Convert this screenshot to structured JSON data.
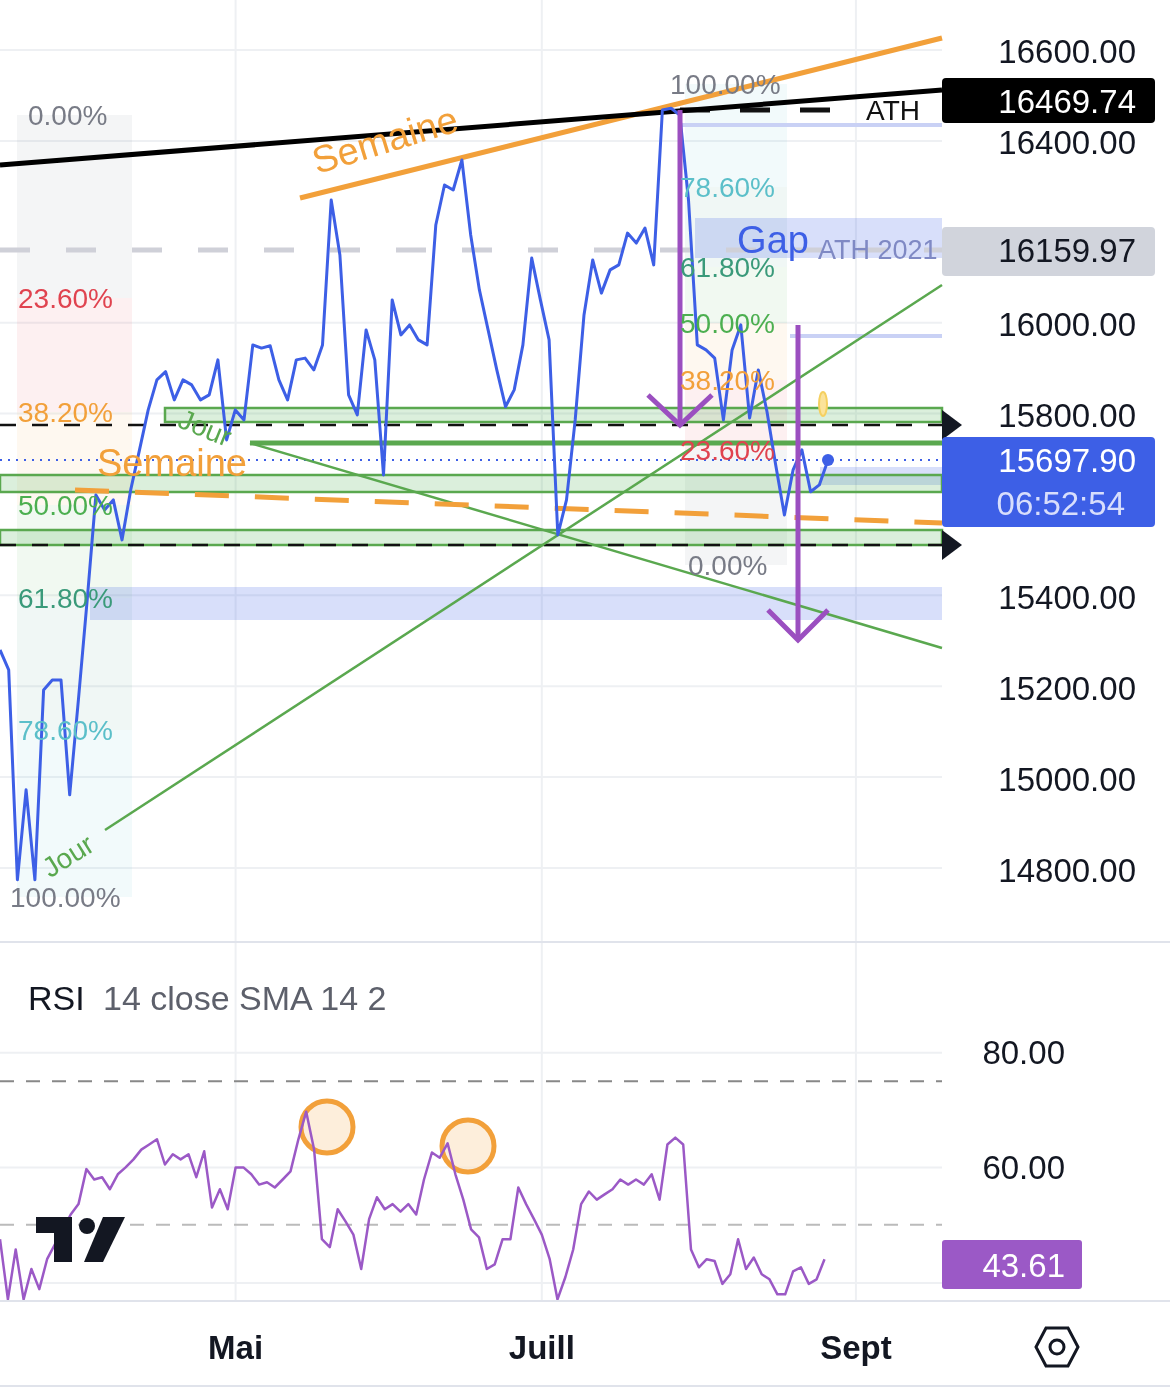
{
  "price_chart": {
    "chart_data": {
      "type": "line",
      "series": [
        {
          "color": "#3d5fe6",
          "values": [
            15280,
            15236,
            14774,
            14972,
            14774,
            15192,
            15214,
            15214,
            14961,
            15170,
            15390,
            15621,
            15588,
            15610,
            15522,
            15632,
            15720,
            15808,
            15874,
            15892,
            15830,
            15874,
            15863,
            15830,
            15841,
            15918,
            15742,
            15808,
            15786,
            15951,
            15944,
            15949,
            15874,
            15830,
            15918,
            15922,
            15896,
            15951,
            16270,
            16149,
            15841,
            15797,
            15984,
            15918,
            15665,
            16050,
            15973,
            15995,
            15962,
            15951,
            16215,
            16303,
            16292,
            16358,
            16193,
            16072,
            15984,
            15896,
            15815,
            15852,
            15951,
            16142,
            16050,
            15962,
            15533,
            15610,
            15786,
            16017,
            16138,
            16065,
            16116,
            16127,
            16197,
            16175,
            16208,
            16127,
            16468,
            16472,
            16457,
            16270,
            15951,
            15940,
            15922,
            15786,
            15940,
            15995,
            15790,
            15896,
            15804,
            15687,
            15577,
            15676,
            15720,
            15628,
            15643,
            15698
          ]
        }
      ],
      "ylim": [
        14635,
        16710
      ],
      "grid": true,
      "ref_lines": [
        {
          "axis": "y",
          "value": 16160,
          "color": "#cfd0d8"
        },
        {
          "axis": "y",
          "value": 15775,
          "color": "#111111"
        },
        {
          "axis": "y",
          "value": 15735,
          "color": "#5aa84f"
        },
        {
          "axis": "y",
          "value": 15698,
          "color": "#3d5fe6"
        },
        {
          "axis": "y",
          "value": 15511,
          "color": "#111111"
        }
      ],
      "yticks": [
        {
          "value": 16600,
          "label": "16600.00"
        },
        {
          "value": 16400,
          "label": "16400.00"
        },
        {
          "value": 16000,
          "label": "16000.00"
        },
        {
          "value": 15800,
          "label": "15800.00"
        },
        {
          "value": 15400,
          "label": "15400.00"
        },
        {
          "value": 15200,
          "label": "15200.00"
        },
        {
          "value": 15000,
          "label": "15000.00"
        },
        {
          "value": 14800,
          "label": "14800.00"
        }
      ]
    }
  },
  "price_badges": [
    {
      "kind": "ath",
      "text": "16469.74"
    },
    {
      "kind": "level",
      "text": "16159.97"
    },
    {
      "kind": "last",
      "text": "15697.90",
      "countdown": "06:52:54"
    }
  ],
  "fib_left": [
    {
      "label": "0.00%",
      "color": "#787b86"
    },
    {
      "label": "23.60%",
      "color": "#e0434f"
    },
    {
      "label": "38.20%",
      "color": "#f2a03a"
    },
    {
      "label": "50.00%",
      "color": "#4caf50"
    },
    {
      "label": "61.80%",
      "color": "#3a9a7a"
    },
    {
      "label": "78.60%",
      "color": "#5bbfc9"
    },
    {
      "label": "100.00%",
      "color": "#787b86"
    }
  ],
  "fib_right": [
    {
      "label": "100.00%",
      "color": "#787b86"
    },
    {
      "label": "78.60%",
      "color": "#5bbfc9"
    },
    {
      "label": "61.80%",
      "color": "#3a9a7a"
    },
    {
      "label": "50.00%",
      "color": "#4caf50"
    },
    {
      "label": "38.20%",
      "color": "#f2a03a"
    },
    {
      "label": "23.60%",
      "color": "#e0434f"
    },
    {
      "label": "0.00%",
      "color": "#787b86"
    }
  ],
  "annotations": [
    {
      "kind": "week",
      "text": "Semaine"
    },
    {
      "kind": "week",
      "text": "Semaine"
    },
    {
      "kind": "day",
      "text": "Jour"
    },
    {
      "kind": "day",
      "text": "Jour"
    },
    {
      "kind": "faded",
      "text": "ATH 2021"
    },
    {
      "kind": "gap",
      "text": "Gap"
    },
    {
      "kind": "level",
      "text": "ATH"
    }
  ],
  "rsi": {
    "title": "RSI",
    "params": "14 close SMA 14 2",
    "value": "43.61",
    "chart_data": {
      "type": "line",
      "categories": [
        null,
        null,
        null,
        null,
        null,
        null,
        null,
        null,
        null,
        null,
        null,
        null,
        null,
        null,
        null,
        null,
        null,
        null,
        null,
        null,
        null,
        null,
        null,
        null,
        null,
        null,
        null,
        null,
        null,
        null,
        "Mai",
        null,
        null,
        null,
        null,
        null,
        null,
        null,
        null,
        null,
        null,
        null,
        null,
        null,
        null,
        null,
        null,
        null,
        null,
        null,
        null,
        null,
        null,
        null,
        null,
        null,
        null,
        null,
        null,
        null,
        null,
        null,
        null,
        null,
        null,
        null,
        null,
        null,
        null,
        "Juill",
        null,
        null,
        null,
        null,
        null,
        null,
        null,
        null,
        null,
        null,
        null,
        null,
        null,
        null,
        null,
        null,
        null,
        null,
        null,
        null,
        null,
        null,
        null,
        null,
        null,
        null,
        null,
        null,
        null,
        null,
        null,
        null,
        null,
        null,
        null,
        null,
        null,
        null,
        null,
        "Sept",
        null,
        null,
        null,
        null,
        null,
        null,
        null,
        null,
        null,
        null,
        null,
        null,
        null,
        null,
        null,
        null,
        null,
        null,
        null,
        null,
        null,
        null,
        null,
        null,
        null,
        null,
        null,
        null,
        null,
        null,
        null,
        null,
        null,
        null,
        null,
        null,
        null,
        null,
        null
      ],
      "series": [
        {
          "color": "#9b59c6",
          "values": [
            47.5,
            37.0,
            45.7,
            37.0,
            42.3,
            38.8,
            44.0,
            null,
            null,
            51.8,
            53.6,
            59.7,
            57.9,
            58.3,
            56.2,
            58.8,
            60.0,
            61.4,
            63.1,
            64.0,
            64.9,
            60.5,
            62.3,
            61.4,
            62.3,
            58.3,
            62.8,
            53.0,
            56.2,
            52.7,
            60.0,
            60.0,
            58.8,
            57.0,
            57.4,
            56.5,
            57.9,
            59.3,
            64.9,
            69.7,
            63.1,
            47.5,
            46.1,
            52.7,
            50.6,
            48.3,
            42.3,
            51.0,
            54.8,
            52.7,
            53.6,
            52.3,
            53.6,
            51.8,
            57.9,
            62.6,
            61.7,
            64.2,
            58.8,
            54.4,
            49.2,
            47.8,
            42.3,
            43.1,
            47.5,
            47.5,
            56.5,
            53.6,
            51.0,
            48.3,
            44.0,
            37.0,
            40.9,
            45.7,
            53.6,
            55.8,
            54.4,
            55.3,
            56.2,
            57.9,
            57.0,
            57.9,
            57.0,
            58.8,
            54.4,
            64.0,
            65.2,
            64.0,
            45.7,
            42.6,
            44.0,
            43.7,
            39.7,
            41.4,
            47.5,
            42.3,
            44.3,
            41.4,
            40.5,
            37.9,
            37.9,
            41.9,
            42.6,
            39.7,
            40.5,
            44.0,
            null,
            null,
            null,
            null,
            null,
            null,
            null,
            null,
            null,
            null,
            null,
            null,
            null,
            null,
            null,
            null,
            null,
            null,
            null,
            null,
            null,
            null,
            null,
            null,
            null,
            null,
            null,
            null,
            null,
            null,
            null,
            null,
            null,
            null,
            null,
            null,
            null,
            null,
            null,
            null,
            null,
            null,
            null
          ]
        }
      ],
      "ylim": [
        36.9,
        99.1
      ],
      "grid": true,
      "ref_lines": [
        {
          "axis": "y",
          "value": 75,
          "color": "#888888"
        },
        {
          "axis": "y",
          "value": 50,
          "color": "#bbbbbb"
        }
      ],
      "yticks": [
        {
          "value": 80,
          "label": "80.00"
        },
        {
          "value": 60,
          "label": "60.00"
        }
      ]
    }
  }
}
